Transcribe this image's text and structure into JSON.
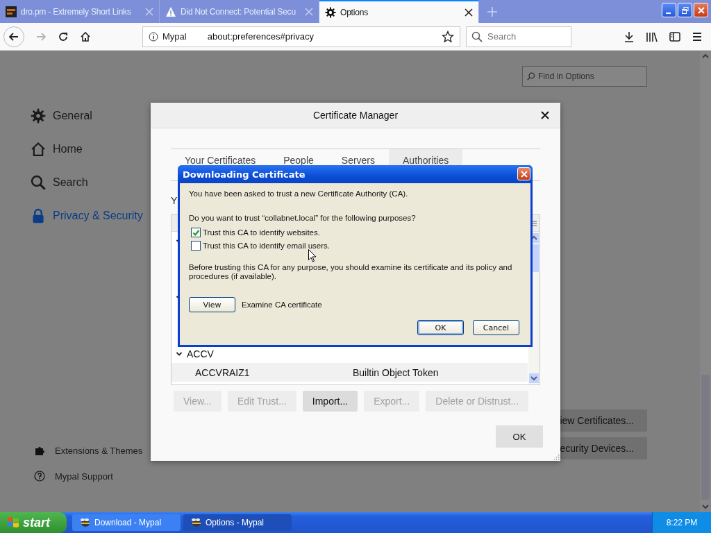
{
  "browser": {
    "tabs": [
      {
        "title": "dro.pm - Extremely Short Links",
        "selected": false
      },
      {
        "title": "Did Not Connect: Potential Secu",
        "selected": false
      },
      {
        "title": "Options",
        "selected": true
      }
    ],
    "url_bar": {
      "identity": "Mypal",
      "value": "about:preferences#privacy"
    },
    "search": {
      "placeholder": "Search"
    }
  },
  "preferences": {
    "find": {
      "placeholder": "Find in Options"
    },
    "categories": [
      {
        "label": "General",
        "selected": false
      },
      {
        "label": "Home",
        "selected": false
      },
      {
        "label": "Search",
        "selected": false
      },
      {
        "label": "Privacy & Security",
        "selected": true
      }
    ],
    "footer_links": [
      "Extensions & Themes",
      "Mypal Support"
    ],
    "background_buttons": [
      "iew Certificates...",
      "ecurity Devices..."
    ]
  },
  "certificate_manager": {
    "title": "Certificate Manager",
    "tabs": [
      {
        "label": "Your Certificates",
        "selected": false
      },
      {
        "label": "People",
        "selected": false
      },
      {
        "label": "Servers",
        "selected": false
      },
      {
        "label": "Authorities",
        "selected": true
      }
    ],
    "intro": "Y",
    "groups": [
      {
        "expanded": true
      },
      {
        "expanded": true
      },
      {
        "label": "ACCV",
        "expanded": true,
        "children": [
          {
            "name": "ACCVRAIZ1",
            "token": "Builtin Object Token"
          }
        ]
      }
    ],
    "buttons": [
      {
        "label": "View...",
        "disabled": true
      },
      {
        "label": "Edit Trust...",
        "disabled": true
      },
      {
        "label": "Import...",
        "disabled": false
      },
      {
        "label": "Export...",
        "disabled": true
      },
      {
        "label": "Delete or Distrust...",
        "disabled": true
      }
    ],
    "ok": "OK"
  },
  "download_dialog": {
    "title": "Downloading Certificate",
    "message": "You have been asked to trust a new Certificate Authority (CA).",
    "question": "Do you want to trust “collabnet.local” for the following purposes?",
    "options": [
      {
        "label": "Trust this CA to identify websites.",
        "checked": true
      },
      {
        "label": "Trust this CA to identify email users.",
        "checked": false
      }
    ],
    "advice": "Before trusting this CA for any purpose, you should examine its certificate and its policy and procedures (if available).",
    "view_button": "View",
    "view_caption": "Examine CA certificate",
    "buttons": [
      {
        "label": "OK",
        "default": true
      },
      {
        "label": "Cancel",
        "default": false
      }
    ]
  },
  "taskbar": {
    "start": "start",
    "tasks": [
      {
        "label": "Download - Mypal",
        "selected": false
      },
      {
        "label": "Options - Mypal",
        "selected": true
      }
    ],
    "clock": "8:22 PM"
  }
}
